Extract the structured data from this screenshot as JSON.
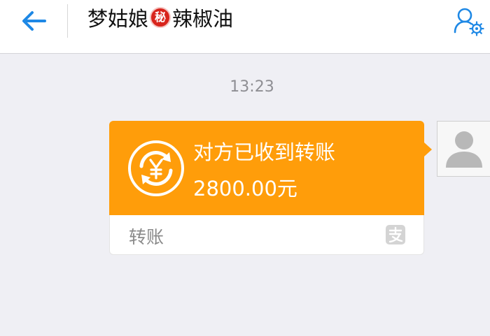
{
  "header": {
    "title_part1": "梦姑娘",
    "secret_badge": "秘",
    "title_part2": "辣椒油",
    "back_icon": "back-arrow-icon",
    "settings_icon": "contact-settings-icon",
    "accent_color": "#1e88e5"
  },
  "chat": {
    "timestamp": "13:23",
    "messages": [
      {
        "type": "transfer",
        "sender": "self",
        "status_text": "对方已收到转账",
        "amount": "2800.00元",
        "footer_label": "转账",
        "footer_icon": "alipay-icon",
        "bubble_color": "#ff9d0a"
      }
    ],
    "avatar_icon": "default-avatar-icon"
  }
}
